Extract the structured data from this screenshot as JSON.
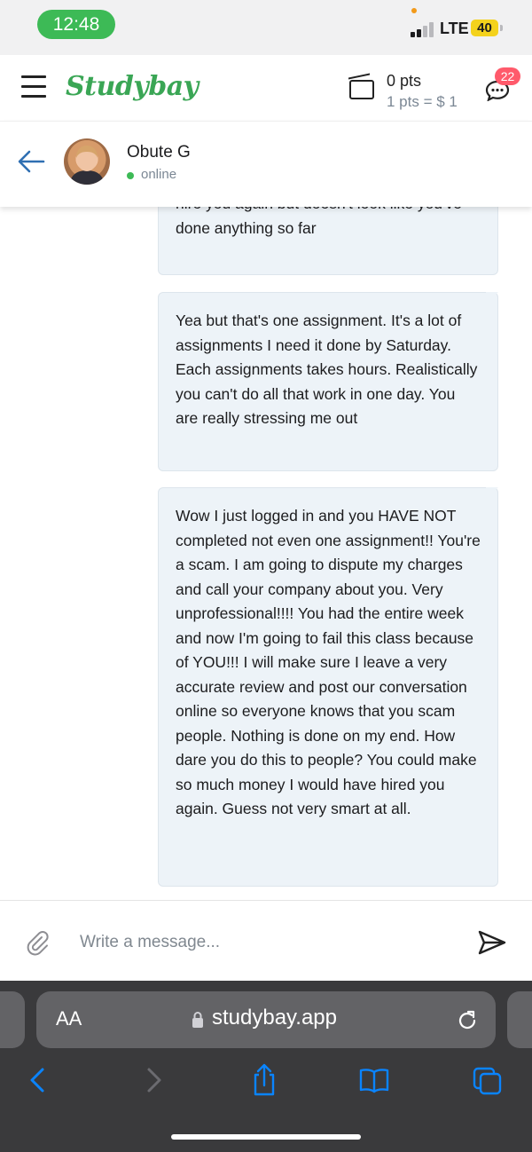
{
  "status_bar": {
    "time": "12:48",
    "network": "LTE",
    "battery": "40"
  },
  "app_header": {
    "logo": "Studybay",
    "points": "0 pts",
    "rate": "1 pts = $ 1",
    "notifications_count": "22"
  },
  "contact": {
    "name": "Obute G",
    "status": "online"
  },
  "messages": [
    {
      "text": "hire you again but doesn't look like you've done anything so far",
      "partial": true
    },
    {
      "text": "Yea but that's one assignment. It's a lot of assignments I need it done by Saturday. Each assignments takes hours. Realistically you can't do all that work in one day. You are really stressing me out"
    },
    {
      "text": "Wow I just logged in and you HAVE NOT completed not even one assignment!! You're a scam. I am going to dispute my charges and call your company about you. Very unprofessional!!!! You had the entire week and now I'm going to fail this class because of YOU!!! I will make sure I leave a very accurate review and post our conversation online so everyone knows that you scam people. Nothing is done on my end. How dare you do this to people? You could make so much money I would have hired you again. Guess not very smart at all."
    }
  ],
  "composer": {
    "placeholder": "Write a message..."
  },
  "browser": {
    "aa_label": "AA",
    "url": "studybay.app"
  },
  "icons": {
    "menu": "hamburger-icon",
    "wallet": "wallet-icon",
    "chat": "chat-bubble-icon",
    "back": "arrow-left-icon",
    "attach": "paperclip-icon",
    "send": "send-icon",
    "lock": "lock-icon",
    "reload": "reload-icon",
    "share": "share-icon",
    "bookmarks": "book-icon",
    "tabs": "tabs-icon"
  },
  "colors": {
    "brand_green": "#3aa655",
    "online_green": "#3dba56",
    "badge_red": "#ff5a6b",
    "bubble_bg": "#edf3f8",
    "safari_blue": "#0a84ff"
  }
}
